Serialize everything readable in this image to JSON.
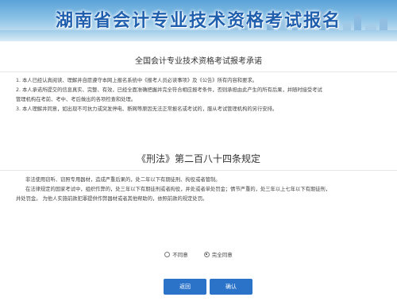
{
  "banner": {
    "title": "湖南省会计专业技术资格考试报名"
  },
  "pledge": {
    "heading": "全国会计专业技术资格考试报考承诺",
    "lines": [
      "1. 本人已经认真阅读、理解并自愿遵守本网上报名系统中《报考人员必读事项》及《公告》所有内容和要求。",
      "2. 本人承诺所提交的信息真实、完整、有效，已经全面准确把握并完全符合相应报考条件，否则承担由此产生的所有后果，并随时接受考试",
      "管理机构在考前、考中、考后做出的各项检查和处理。",
      "3. 本人理解并同意，如出现不可抗力或突发停电、断网等原因无法正常报名或考试的，服从考试管理机构的另行安排。"
    ]
  },
  "law": {
    "heading": "《刑法》第二百八十四条规定",
    "lines": [
      "非法使用窃听、窃照专用器材，造成严重后果的，处二年以下有期徒刑、拘役或者管制。",
      "在法律规定的国家考试中，组织作弊的，处三年以下有期徒刑或者拘役，并处或者单处罚金；情节严重的，处三年以上七年以下有期徒刑，",
      "并处罚金。 为他人实施前款犯罪提供作弊器材或者其他帮助的，依照前款的规定处罚。"
    ]
  },
  "agreement": {
    "disagree_label": "不同意",
    "agree_label": "完全同意",
    "selected": "agree"
  },
  "actions": {
    "back_label": "返回",
    "confirm_label": "确认"
  }
}
